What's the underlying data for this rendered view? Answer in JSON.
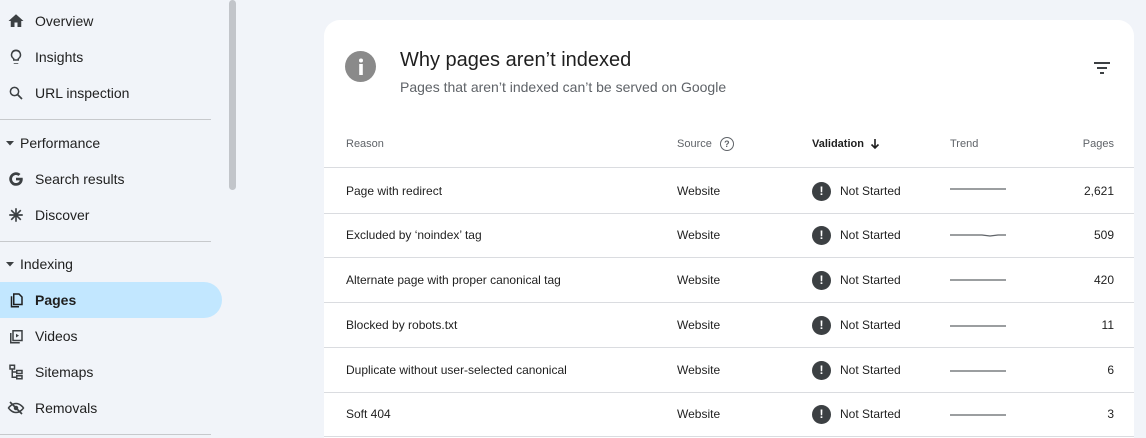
{
  "sidebar": {
    "items_top": [
      {
        "label": "Overview",
        "icon": "home-icon"
      },
      {
        "label": "Insights",
        "icon": "lightbulb-icon"
      },
      {
        "label": "URL inspection",
        "icon": "search-icon"
      }
    ],
    "sections": [
      {
        "label": "Performance",
        "items": [
          {
            "label": "Search results",
            "icon": "google-g-icon"
          },
          {
            "label": "Discover",
            "icon": "asterisk-icon"
          }
        ]
      },
      {
        "label": "Indexing",
        "items": [
          {
            "label": "Pages",
            "icon": "pages-icon",
            "active": true
          },
          {
            "label": "Videos",
            "icon": "video-page-icon"
          },
          {
            "label": "Sitemaps",
            "icon": "sitemap-icon"
          },
          {
            "label": "Removals",
            "icon": "eye-off-icon"
          }
        ]
      }
    ]
  },
  "card": {
    "title": "Why pages aren’t indexed",
    "subtitle": "Pages that aren’t indexed can’t be served on Google",
    "columns": {
      "reason": "Reason",
      "source": "Source",
      "validation": "Validation",
      "trend": "Trend",
      "pages": "Pages"
    },
    "rows": [
      {
        "reason": "Page with redirect",
        "source": "Website",
        "validation": "Not Started",
        "pages": "2,621"
      },
      {
        "reason": "Excluded by ‘noindex’ tag",
        "source": "Website",
        "validation": "Not Started",
        "pages": "509"
      },
      {
        "reason": "Alternate page with proper canonical tag",
        "source": "Website",
        "validation": "Not Started",
        "pages": "420"
      },
      {
        "reason": "Blocked by robots.txt",
        "source": "Website",
        "validation": "Not Started",
        "pages": "11"
      },
      {
        "reason": "Duplicate without user-selected canonical",
        "source": "Website",
        "validation": "Not Started",
        "pages": "6"
      },
      {
        "reason": "Soft 404",
        "source": "Website",
        "validation": "Not Started",
        "pages": "3"
      }
    ]
  },
  "colors": {
    "active_bg": "#c2e7ff",
    "status_icon": "#3c4043",
    "badge": "#8a8a8a"
  }
}
